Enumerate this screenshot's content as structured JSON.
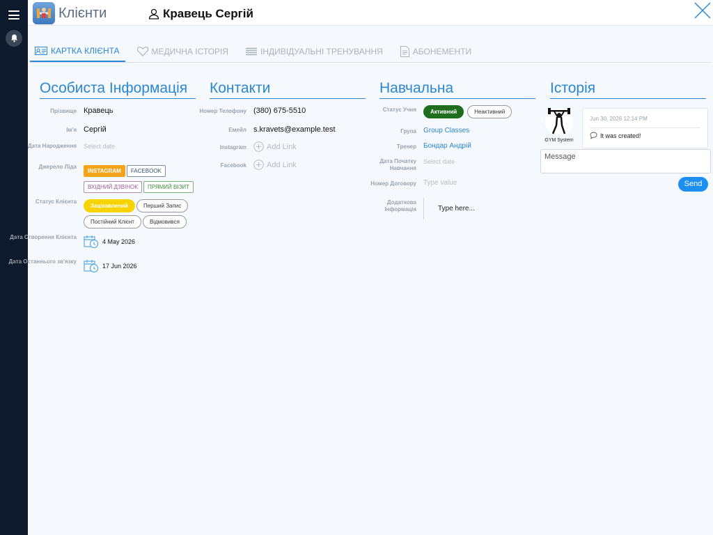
{
  "header": {
    "app_title": "Клієнти",
    "client_name": "Кравець Сергій"
  },
  "tabs": [
    {
      "label": "КАРТКА КЛІЄНТА",
      "icon": "id-card-icon"
    },
    {
      "label": "МЕДИЧНА ІСТОРІЯ",
      "icon": "heart-icon"
    },
    {
      "label": "ІНДИВІДУАЛЬНІ ТРЕНУВАННЯ",
      "icon": "list-icon"
    },
    {
      "label": "АБОНЕМЕНТИ",
      "icon": "document-icon"
    }
  ],
  "personal": {
    "title": "Особиста Інформація",
    "surname_label": "Прізвище",
    "surname": "Кравець",
    "name_label": "Ім'я",
    "name": "Сергій",
    "birth_label": "Дата Народження",
    "birth_placeholder": "Select date",
    "source_label": "Джерело Ліда",
    "sources": [
      "INSTAGRAM",
      "FACEBOOK",
      "ВХІДНИЙ ДЗВІНОК",
      "ПРЯМИЙ ВІЗИТ"
    ],
    "status_label": "Статус Клієнта",
    "statuses": [
      "Зацікавлений",
      "Перший Запис",
      "Постійний Клієнт",
      "Відмовився"
    ],
    "created_label": "Дата Створення Клієнта",
    "created": "4 May 2026",
    "last_contact_label": "Дата Останнього зв'язку",
    "last_contact": "17 Jun 2026"
  },
  "contacts": {
    "title": "Контакти",
    "phone_label": "Номер Телефону",
    "phone": "(380) 675-5510",
    "email_label": "Емейл",
    "email": "s.kravets@example.test",
    "instagram_label": "Instagram",
    "instagram_add": "Add Link",
    "facebook_label": "Facebook",
    "facebook_add": "Add Link"
  },
  "study": {
    "title": "Навчальна",
    "status_label": "Статус Учня",
    "active": "Активний",
    "inactive": "Неактивний",
    "group_label": "Група",
    "group": "Group Classes",
    "trainer_label": "Тренер",
    "trainer": "Бондар Андрій",
    "start_label": "Дата Початку Навчання",
    "start_placeholder": "Select date",
    "contract_label": "Номер Договору",
    "contract_placeholder": "Type value",
    "extra_label": "Додаткова Інформація",
    "extra_placeholder": "Type here..."
  },
  "history": {
    "title": "Історія",
    "author": "GYM System",
    "timestamp": "Jun 30, 2026 12:14 PM",
    "entry": "It was created!",
    "message_placeholder": "Message",
    "send": "Send"
  },
  "colors": {
    "accent": "#2b87d1",
    "instagram": "#f5a31a",
    "active_status": "#1e6e1e",
    "interested": "#f7d300",
    "send": "#1e8ff2",
    "sidebar": "#0d1a2b"
  }
}
